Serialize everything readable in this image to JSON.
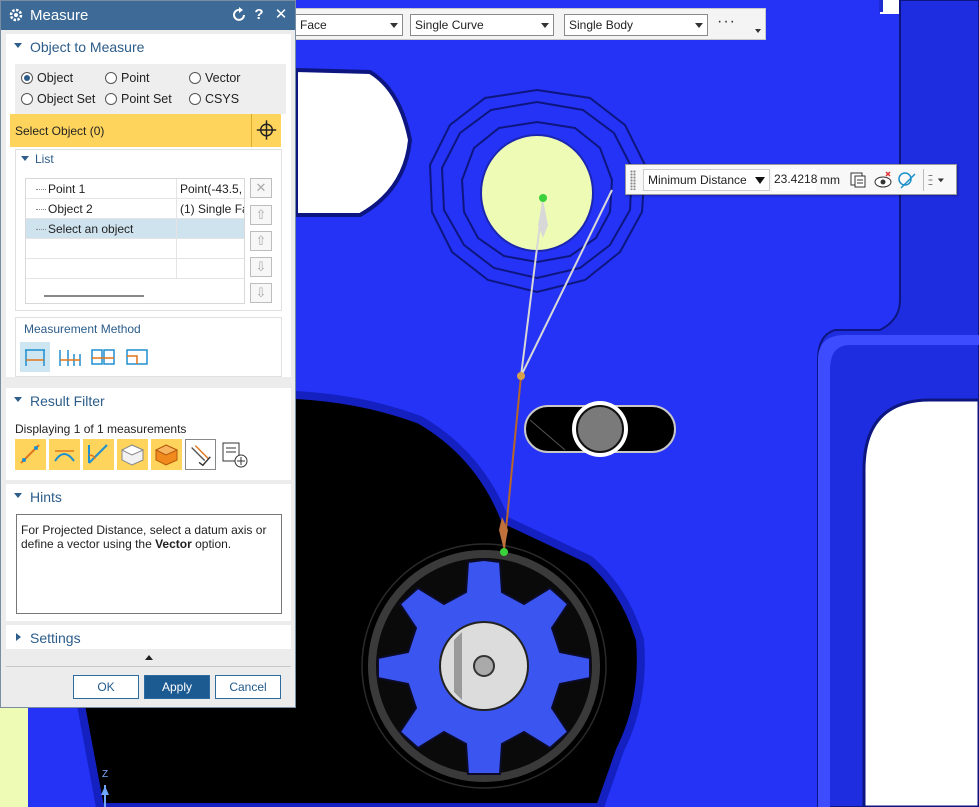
{
  "toolbar": {
    "face_filter": "Face",
    "curve_rule": "Single Curve",
    "body_rule": "Single Body",
    "more_label": "···"
  },
  "result": {
    "measure_type": "Minimum Distance",
    "value": "23.4218",
    "unit": "mm"
  },
  "dialog": {
    "title": "Measure",
    "object_section": {
      "title": "Object to Measure",
      "radios": [
        {
          "label": "Object",
          "selected": true
        },
        {
          "label": "Point",
          "selected": false
        },
        {
          "label": "Vector",
          "selected": false
        },
        {
          "label": "Object Set",
          "selected": false
        },
        {
          "label": "Point Set",
          "selected": false
        },
        {
          "label": "CSYS",
          "selected": false
        }
      ],
      "select_prompt": "Select Object (0)"
    },
    "list": {
      "title": "List",
      "rows": [
        {
          "name": "Point 1",
          "value": "Point(-43.5,"
        },
        {
          "name": "Object 2",
          "value": "(1) Single Fa"
        },
        {
          "name": "Select an object",
          "value": ""
        }
      ]
    },
    "measurement_method": {
      "title": "Measurement Method"
    },
    "result_filter": {
      "title": "Result Filter",
      "summary": "Displaying 1 of 1 measurements"
    },
    "hints": {
      "title": "Hints",
      "text_before": "For Projected Distance, select a datum axis or define a vector using the ",
      "text_bold": "Vector",
      "text_after": " option."
    },
    "settings": {
      "title": "Settings"
    },
    "buttons": {
      "ok": "OK",
      "apply": "Apply",
      "cancel": "Cancel"
    }
  },
  "colors": {
    "part_blue": "#2433f5",
    "title_bar": "#3d6a96",
    "select_highlight": "#ffd45c",
    "hole_fill": "#eefbb4"
  },
  "axis_label": "Z"
}
